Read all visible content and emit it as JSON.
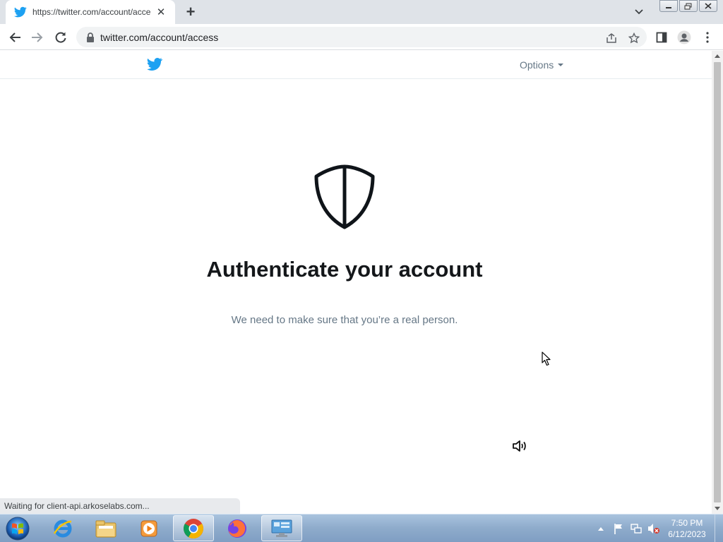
{
  "browser": {
    "tab": {
      "title": "https://twitter.com/account/acce",
      "close_symbol": "✕"
    },
    "new_tab_symbol": "+",
    "address_bar": {
      "url": "twitter.com/account/access"
    }
  },
  "page": {
    "header": {
      "options_label": "Options"
    },
    "title": "Authenticate your account",
    "subtitle": "We need to make sure that you’re a real person."
  },
  "status_bar": {
    "text": "Waiting for client-api.arkoselabs.com..."
  },
  "taskbar": {
    "apps": [
      "internet-explorer",
      "windows-explorer",
      "media-player",
      "chrome",
      "firefox",
      "remote-desktop"
    ],
    "clock": {
      "time": "7:50 PM",
      "date": "6/12/2023"
    }
  },
  "colors": {
    "twitter_blue": "#1da1f2",
    "heading": "#14171a",
    "secondary_text": "#657786"
  }
}
